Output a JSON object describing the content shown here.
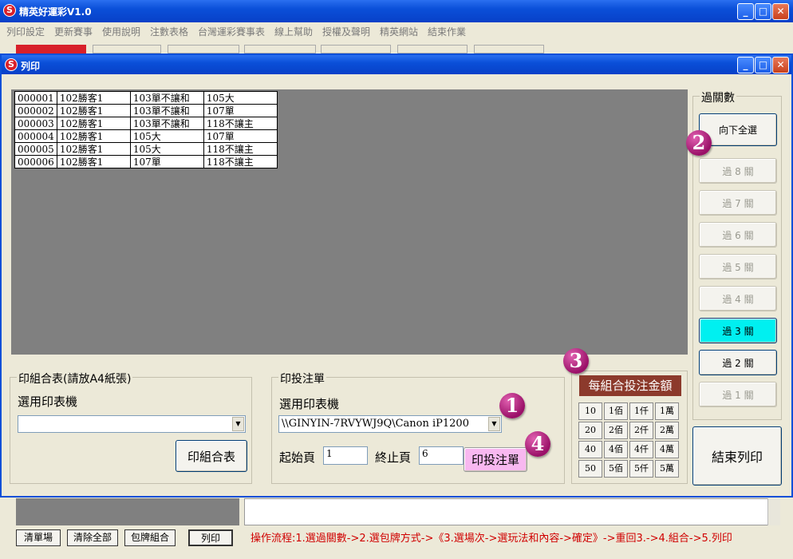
{
  "app": {
    "title": "精英好運彩V1.0",
    "logo_letter": "S",
    "menu": [
      "列印設定",
      "更新賽事",
      "使用說明",
      "注數表格",
      "台灣運彩賽事表",
      "線上幫助",
      "授權及聲明",
      "精英網站",
      "結束作業"
    ]
  },
  "dialog": {
    "title": "列印",
    "bets_table": [
      [
        "000001",
        "102勝客1",
        "103單不讓和",
        "105大"
      ],
      [
        "000002",
        "102勝客1",
        "103單不讓和",
        "107單"
      ],
      [
        "000003",
        "102勝客1",
        "103單不讓和",
        "118不讓主"
      ],
      [
        "000004",
        "102勝客1",
        "105大",
        "107單"
      ],
      [
        "000005",
        "102勝客1",
        "105大",
        "118不讓主"
      ],
      [
        "000006",
        "102勝客1",
        "107單",
        "118不讓主"
      ]
    ],
    "parlay": {
      "label": "過關數",
      "select_down": "向下全選",
      "levels": [
        "過 8 關",
        "過 7 關",
        "過 6 關",
        "過 5 關",
        "過 4 關",
        "過 3 關",
        "過 2 關",
        "過 1 關"
      ],
      "active_level": "過 3 關"
    },
    "combo_print": {
      "label": "印組合表(請放A4紙張)",
      "printer_label": "選用印表機",
      "printer_value": "",
      "button": "印組合表"
    },
    "bet_print": {
      "label": "印投注單",
      "printer_label": "選用印表機",
      "printer_value": "\\\\GINYIN-7RVYWJ9Q\\Canon iP1200",
      "start_label": "起始頁",
      "start_value": "1",
      "end_label": "終止頁",
      "end_value": "6",
      "button": "印投注單"
    },
    "amount": {
      "title": "每組合投注金額",
      "grid": [
        [
          "10",
          "1佰",
          "1仟",
          "1萬"
        ],
        [
          "20",
          "2佰",
          "2仟",
          "2萬"
        ],
        [
          "40",
          "4佰",
          "4仟",
          "4萬"
        ],
        [
          "50",
          "5佰",
          "5仟",
          "5萬"
        ]
      ]
    },
    "close_button": "結束列印",
    "badges": [
      "1",
      "2",
      "3",
      "4"
    ]
  },
  "bottom": {
    "buttons": [
      "清單場",
      "清除全部",
      "包牌組合",
      "列印"
    ],
    "instructions": "操作流程:1.選過關數->2.選包牌方式->《3.選場次->選玩法和內容->確定》->重回3.->4.組合->5.列印"
  },
  "colors": {
    "titlebar": "#0a4fd8",
    "active_level": "#00f0f0",
    "badge": "#b0207a",
    "amount_header": "#8c3a2c",
    "instructions": "#d00000"
  }
}
